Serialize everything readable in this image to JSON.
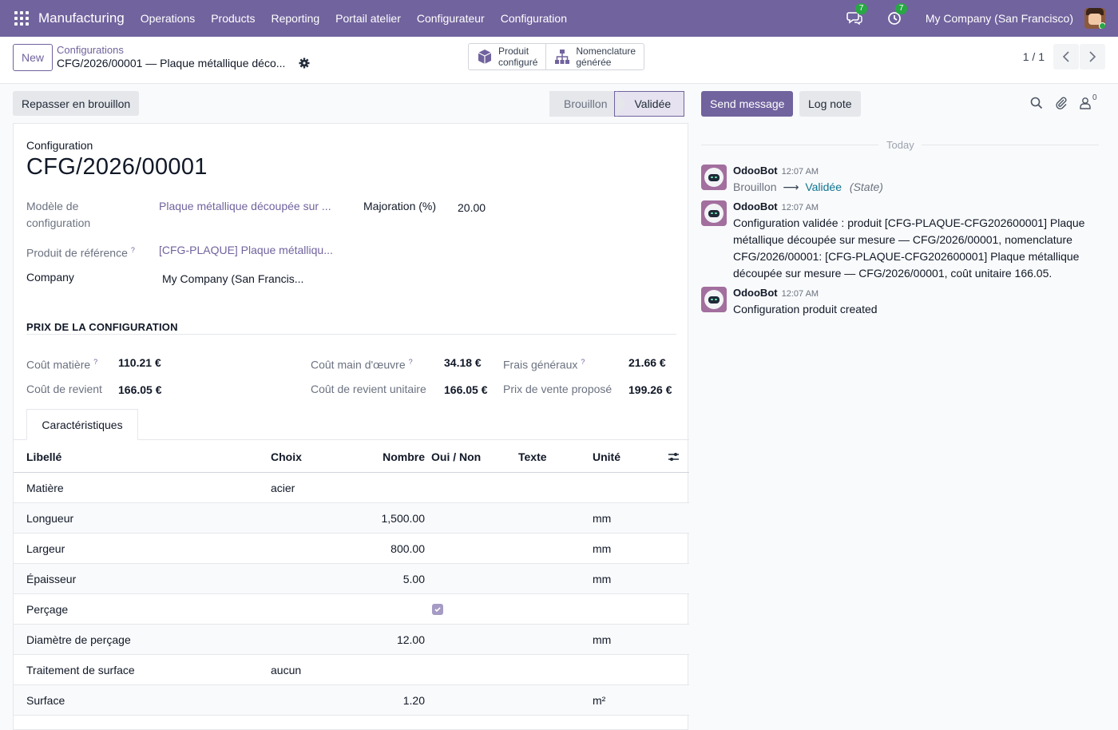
{
  "navbar": {
    "app_name": "Manufacturing",
    "menu": [
      "Operations",
      "Products",
      "Reporting",
      "Portail atelier",
      "Configurateur",
      "Configuration"
    ],
    "messages_count": "7",
    "activities_count": "7",
    "company": "My Company (San Francisco)"
  },
  "control": {
    "new_label": "New",
    "breadcrumb_parent": "Configurations",
    "breadcrumb_current": "CFG/2026/00001 — Plaque métallique déco...",
    "smart_btn_product": [
      "Produit",
      "configuré"
    ],
    "smart_btn_bom": [
      "Nomenclature",
      "générée"
    ],
    "pager": "1 / 1"
  },
  "status": {
    "reset_label": "Repasser en brouillon",
    "stage_draft": "Brouillon",
    "stage_validated": "Validée"
  },
  "form": {
    "ref_label": "Configuration",
    "reference": "CFG/2026/00001",
    "model_label_1": "Modèle de",
    "model_label_2": "configuration",
    "model_value": "Plaque métallique découpée sur ...",
    "markup_label": "Majoration (%)",
    "markup_value": "20.00",
    "ref_product_label": "Produit de référence",
    "ref_product_value": "[CFG-PLAQUE] Plaque métalliqu...",
    "company_label": "Company",
    "company_value": "My Company (San Francis...",
    "pricing_title": "PRIX DE LA CONFIGURATION",
    "prices": {
      "material_label": "Coût matière",
      "material_value": "110.21 €",
      "labor_label": "Coût main d'œuvre",
      "labor_value": "34.18 €",
      "overhead_label": "Frais généraux",
      "overhead_value": "21.66 €",
      "cost_label": "Coût de revient",
      "cost_value": "166.05 €",
      "unit_cost_label": "Coût de revient unitaire",
      "unit_cost_value": "166.05 €",
      "sale_label": "Prix de vente proposé",
      "sale_value": "199.26 €"
    },
    "tab_label": "Caractéristiques"
  },
  "table": {
    "headers": {
      "label": "Libellé",
      "choice": "Choix",
      "number": "Nombre",
      "yesno": "Oui / Non",
      "text": "Texte",
      "unit": "Unité"
    },
    "rows": [
      {
        "label": "Matière",
        "choice": "acier",
        "number": "",
        "yesno": false,
        "text": "",
        "unit": ""
      },
      {
        "label": "Longueur",
        "choice": "",
        "number": "1,500.00",
        "yesno": false,
        "text": "",
        "unit": "mm"
      },
      {
        "label": "Largeur",
        "choice": "",
        "number": "800.00",
        "yesno": false,
        "text": "",
        "unit": "mm"
      },
      {
        "label": "Épaisseur",
        "choice": "",
        "number": "5.00",
        "yesno": false,
        "text": "",
        "unit": "mm"
      },
      {
        "label": "Perçage",
        "choice": "",
        "number": "",
        "yesno": true,
        "text": "",
        "unit": ""
      },
      {
        "label": "Diamètre de perçage",
        "choice": "",
        "number": "12.00",
        "yesno": false,
        "text": "",
        "unit": "mm"
      },
      {
        "label": "Traitement de surface",
        "choice": "aucun",
        "number": "",
        "yesno": false,
        "text": "",
        "unit": ""
      },
      {
        "label": "Surface",
        "choice": "",
        "number": "1.20",
        "yesno": false,
        "text": "",
        "unit": "m²"
      }
    ]
  },
  "chatter": {
    "send_label": "Send message",
    "log_label": "Log note",
    "followers_count": "0",
    "date_separator": "Today",
    "messages": [
      {
        "author": "OdooBot",
        "time": "12:07 AM",
        "old": "Brouillon",
        "new": "Validée",
        "field": "(State)"
      },
      {
        "author": "OdooBot",
        "time": "12:07 AM",
        "body": "Configuration validée : produit [CFG-PLAQUE-CFG202600001] Plaque métallique découpée sur mesure — CFG/2026/00001, nomenclature CFG/2026/00001: [CFG-PLAQUE-CFG202600001] Plaque métallique découpée sur mesure — CFG/2026/00001, coût unitaire 166.05."
      },
      {
        "author": "OdooBot",
        "time": "12:07 AM",
        "body": "Configuration produit created"
      }
    ]
  }
}
